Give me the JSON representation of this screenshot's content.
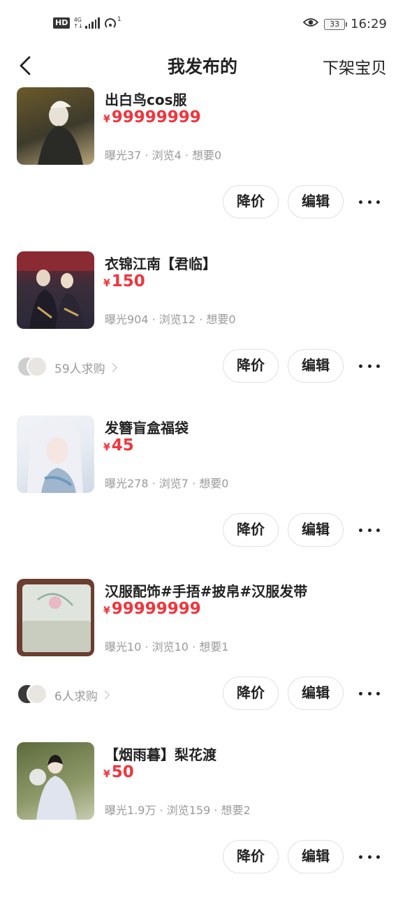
{
  "status_bar": {
    "hd": "HD",
    "network_top": "4G",
    "network_bottom": "↑↓",
    "hotspot_sup": "1",
    "battery": "33",
    "time": "16:29"
  },
  "header": {
    "title": "我发布的",
    "action": "下架宝贝"
  },
  "actions": {
    "reduce_price": "降价",
    "edit": "编辑"
  },
  "items": [
    {
      "title": "出白鸟cos服",
      "currency": "¥",
      "price": "99999999",
      "stats": "曝光37 · 浏览4 · 想要0",
      "wanted": "",
      "thumb_colors": [
        "#6b5a2a",
        "#3d3a2c",
        "#b8a57a"
      ]
    },
    {
      "title": "衣锦江南【君临】",
      "currency": "¥",
      "price": "150",
      "stats": "曝光904 · 浏览12 · 想要0",
      "wanted": "59人求购",
      "thumb_colors": [
        "#7a2230",
        "#2b2838",
        "#c9a460"
      ]
    },
    {
      "title": "发簪盲盒福袋",
      "currency": "¥",
      "price": "45",
      "stats": "曝光278 · 浏览7 · 想要0",
      "wanted": "",
      "thumb_colors": [
        "#e8ecf2",
        "#cfd9e6",
        "#9fb6cc"
      ]
    },
    {
      "title": "汉服配饰#手捂#披帛#汉服发带",
      "currency": "¥",
      "price": "99999999",
      "stats": "曝光10 · 浏览10 · 想要1",
      "wanted": "6人求购",
      "thumb_colors": [
        "#d8dcd2",
        "#6a3e30",
        "#b9c7bd"
      ]
    },
    {
      "title": "【烟雨暮】梨花渡",
      "currency": "¥",
      "price": "50",
      "stats": "曝光1.9万 · 浏览159 · 想要2",
      "wanted": "",
      "thumb_colors": [
        "#5d6b3c",
        "#d7dde8",
        "#8f9a6a"
      ]
    }
  ]
}
